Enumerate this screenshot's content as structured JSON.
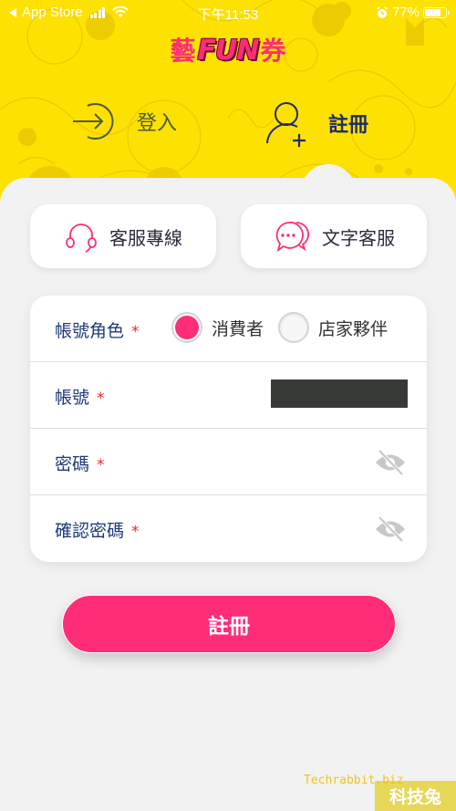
{
  "status_bar": {
    "back_app": "App Store",
    "time": "下午11:53",
    "battery": "77%",
    "battery_level": 0.77
  },
  "logo": {
    "left_char": "藝",
    "middle": "FUN",
    "right_char": "券"
  },
  "auth_tabs": {
    "login": "登入",
    "register": "註冊",
    "active": "register"
  },
  "support": {
    "phone_label": "客服專線",
    "chat_label": "文字客服"
  },
  "form": {
    "required_mark": "*",
    "role": {
      "label": "帳號角色",
      "options": [
        "消費者",
        "店家夥伴"
      ],
      "selected": "消費者"
    },
    "account": {
      "label": "帳號",
      "value": ""
    },
    "password": {
      "label": "密碼",
      "value": ""
    },
    "confirm_password": {
      "label": "確認密碼",
      "value": ""
    }
  },
  "submit_label": "註冊",
  "watermark": {
    "text": "Techrabbit.biz",
    "badge": "科技兔"
  },
  "colors": {
    "accent": "#ff2d78",
    "header_yellow": "#fde100",
    "label_blue": "#1f3a78",
    "required_red": "#e8282f"
  }
}
